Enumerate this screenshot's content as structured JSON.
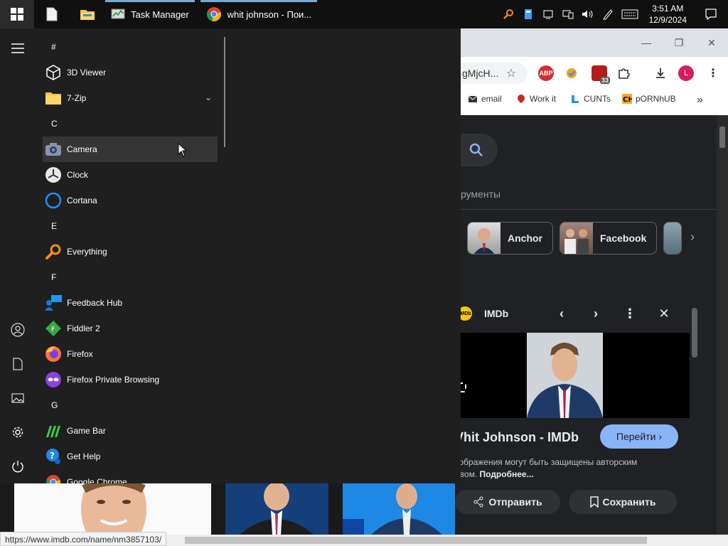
{
  "taskbar": {
    "apps": [
      {
        "label": "Task Manager",
        "icon": "task-manager-icon"
      },
      {
        "label": "whit johnson - Пои...",
        "icon": "chrome-icon"
      }
    ],
    "clock_time": "3:51 AM",
    "clock_date": "12/9/2024"
  },
  "start_menu": {
    "groups": [
      {
        "letter": "#",
        "apps": [
          {
            "name": "3D Viewer",
            "icon": "3d-viewer-icon"
          },
          {
            "name": "7-Zip",
            "icon": "folder-icon",
            "expandable": true
          }
        ]
      },
      {
        "letter": "C",
        "apps": [
          {
            "name": "Camera",
            "icon": "camera-icon"
          },
          {
            "name": "Clock",
            "icon": "clock-icon"
          },
          {
            "name": "Cortana",
            "icon": "cortana-icon"
          }
        ]
      },
      {
        "letter": "E",
        "apps": [
          {
            "name": "Everything",
            "icon": "everything-icon"
          }
        ]
      },
      {
        "letter": "F",
        "apps": [
          {
            "name": "Feedback Hub",
            "icon": "feedback-hub-icon"
          },
          {
            "name": "Fiddler 2",
            "icon": "fiddler-icon"
          },
          {
            "name": "Firefox",
            "icon": "firefox-icon"
          },
          {
            "name": "Firefox Private Browsing",
            "icon": "firefox-private-icon"
          }
        ]
      },
      {
        "letter": "G",
        "apps": [
          {
            "name": "Game Bar",
            "icon": "game-bar-icon"
          },
          {
            "name": "Get Help",
            "icon": "get-help-icon"
          },
          {
            "name": "Google Chrome",
            "icon": "chrome-icon"
          }
        ]
      }
    ],
    "hovered_app": "Camera"
  },
  "browser": {
    "omnibox_text": "gMjcH...",
    "profile_letter": "L",
    "ext_badge": "33",
    "ext_abp": "ABP",
    "bookmarks": [
      "email",
      "Work it",
      "CUNTs",
      "pORNhUB"
    ],
    "bookmarks_more": "»",
    "tools_label": "рументы",
    "chips": [
      "Anchor",
      "Facebook"
    ],
    "panel": {
      "source": "IMDb",
      "title": "Vhit Johnson - IMDb",
      "goto_label": "Перейти",
      "note_text": "зображения могут быть защищены авторским",
      "note_text2": "авом.",
      "note_link": "Подробнее...",
      "share_label": "Отправить",
      "save_label": "Сохранить"
    }
  },
  "status_url": "https://www.imdb.com/name/nm3857103/"
}
